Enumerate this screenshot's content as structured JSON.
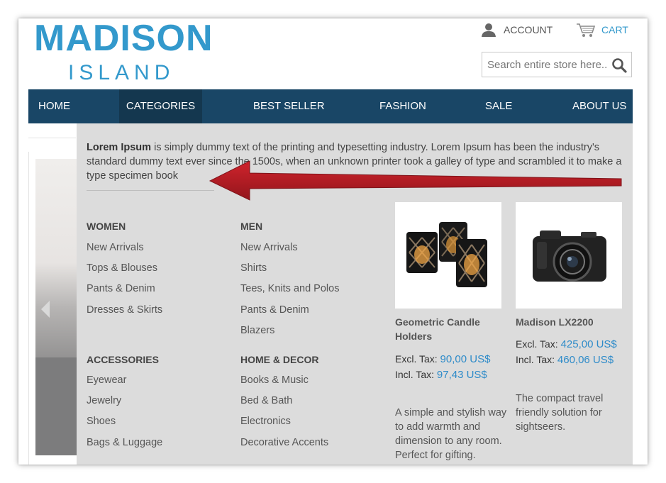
{
  "header": {
    "logo_line1": "MADISON",
    "logo_line2": "ISLAND",
    "account_label": "ACCOUNT",
    "cart_label": "CART",
    "search_placeholder": "Search entire store here..."
  },
  "nav": {
    "items": [
      "HOME",
      "CATEGORIES",
      "BEST SELLER",
      "FASHION",
      "SALE",
      "ABOUT US"
    ],
    "active": "CATEGORIES"
  },
  "dropdown": {
    "intro_bold": "Lorem Ipsum",
    "intro_rest": " is simply dummy text of the printing and typesetting industry. Lorem Ipsum has been the industry's standard dummy text ever since the 1500s, when an unknown printer took a galley of type and scrambled it to make a type specimen book",
    "women": {
      "heading": "WOMEN",
      "links": [
        "New Arrivals",
        "Tops & Blouses",
        "Pants & Denim",
        "Dresses & Skirts"
      ]
    },
    "men": {
      "heading": "MEN",
      "links": [
        "New Arrivals",
        "Shirts",
        "Tees, Knits and Polos",
        "Pants & Denim",
        "Blazers"
      ]
    },
    "accessories": {
      "heading": "ACCESSORIES",
      "links": [
        "Eyewear",
        "Jewelry",
        "Shoes",
        "Bags & Luggage"
      ]
    },
    "home_decor": {
      "heading": "HOME & DECOR",
      "links": [
        "Books & Music",
        "Bed & Bath",
        "Electronics",
        "Decorative Accents"
      ]
    },
    "products": [
      {
        "name_line1": "Geometric Candle",
        "name_line2": "Holders",
        "excl_label": "Excl. Tax:",
        "excl_price": "90,00 US$",
        "incl_label": "Incl. Tax:",
        "incl_price": "97,43 US$",
        "desc_lines": [
          "A simple and stylish way",
          "to add warmth and",
          "dimension to any room.",
          "Perfect for gifting."
        ],
        "image_icon": "candle-holders-image"
      },
      {
        "name_line1": "Madison LX2200",
        "excl_label": "Excl. Tax:",
        "excl_price": "425,00 US$",
        "incl_label": "Incl. Tax:",
        "incl_price": "460,06 US$",
        "desc_lines": [
          "The compact travel",
          "friendly solution for",
          "sightseers."
        ],
        "image_icon": "camera-image"
      }
    ]
  },
  "colors": {
    "brand_blue": "#3399cc",
    "nav_bg": "#194666",
    "dropdown_bg": "#dcdcdc",
    "price_blue": "#2e8bc9",
    "annotation_red": "#b5121b"
  }
}
